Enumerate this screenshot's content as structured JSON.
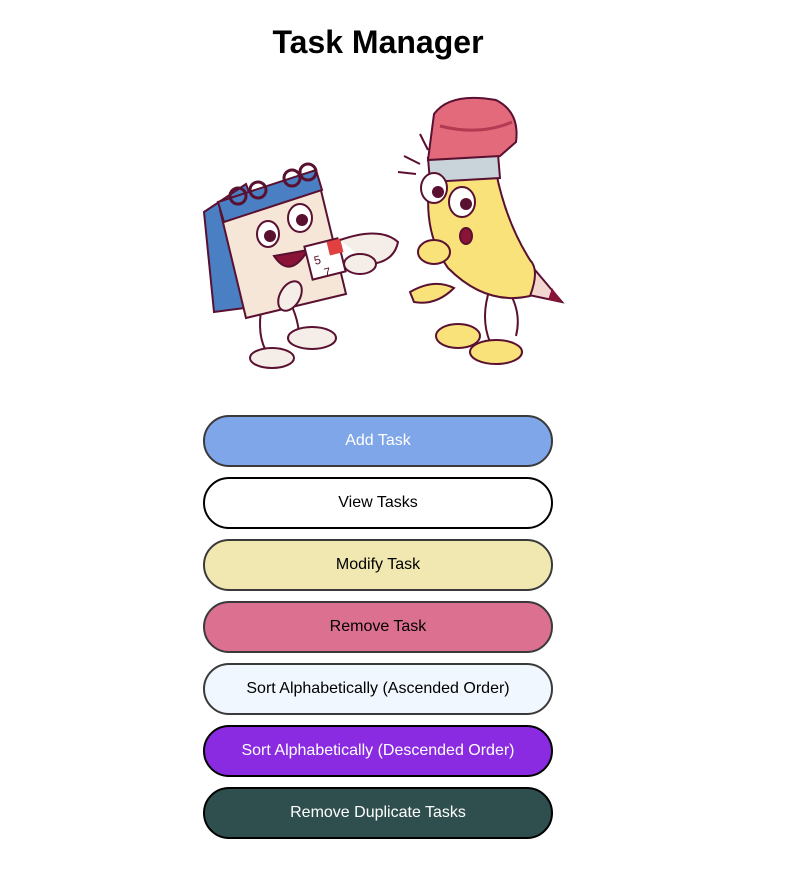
{
  "header": {
    "title": "Task Manager"
  },
  "illustration": {
    "calendar_digits": [
      "5",
      "7"
    ]
  },
  "menu": {
    "buttons": [
      {
        "label": "Add Task",
        "bg": "#7fa6e8",
        "fg": "#ffffff",
        "border": "#3a3a3a"
      },
      {
        "label": "View Tasks",
        "bg": "#ffffff",
        "fg": "#000000",
        "border": "#000000"
      },
      {
        "label": "Modify Task",
        "bg": "#f0e8b0",
        "fg": "#000000",
        "border": "#3a3a3a"
      },
      {
        "label": "Remove Task",
        "bg": "#db7090",
        "fg": "#000000",
        "border": "#3a3a3a"
      },
      {
        "label": "Sort Alphabetically (Ascended Order)",
        "bg": "#f0f7fe",
        "fg": "#000000",
        "border": "#3a3a3a"
      },
      {
        "label": "Sort Alphabetically (Descended Order)",
        "bg": "#8a2be2",
        "fg": "#ffffff",
        "border": "#000000"
      },
      {
        "label": "Remove Duplicate Tasks",
        "bg": "#2f4f4f",
        "fg": "#ffffff",
        "border": "#000000"
      }
    ]
  }
}
